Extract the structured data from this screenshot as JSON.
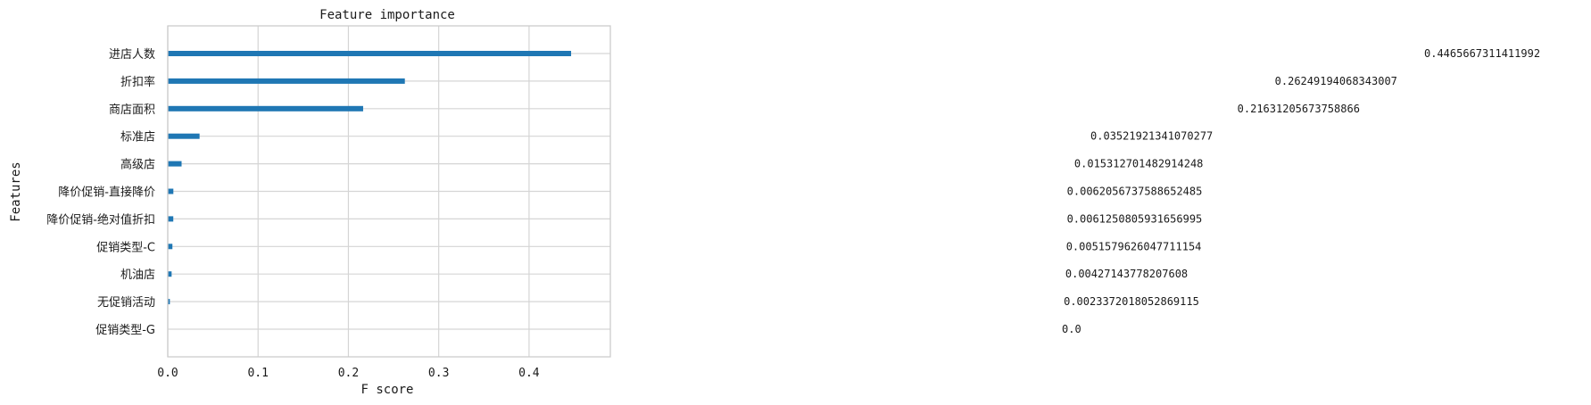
{
  "chart_data": {
    "type": "bar",
    "orientation": "horizontal",
    "title": "Feature importance",
    "xlabel": "F score",
    "ylabel": "Features",
    "categories": [
      "进店人数",
      "折扣率",
      "商店面积",
      "标准店",
      "高级店",
      "降价促销-直接降价",
      "降价促销-绝对值折扣",
      "促销类型-C",
      "机油店",
      "无促销活动",
      "促销类型-G"
    ],
    "values": [
      0.4465667311411992,
      0.26249194068343007,
      0.21631205673758866,
      0.03521921341070277,
      0.015312701482914248,
      0.0062056737588652485,
      0.0061250805931656995,
      0.0051579626047711154,
      0.00427143778207608,
      0.0023372018052869115,
      0.0
    ],
    "data_labels": [
      "0.4465667311411992",
      "0.26249194068343007",
      "0.21631205673758866",
      "0.03521921341070277",
      "0.015312701482914248",
      "0.0062056737588652485",
      "0.0061250805931656995",
      "0.0051579626047711154",
      "0.00427143778207608",
      "0.0023372018052869115",
      "0.0"
    ],
    "xticks": [
      "0.0",
      "0.1",
      "0.2",
      "0.3",
      "0.4"
    ],
    "xlim": [
      0,
      0.49
    ],
    "grid": true,
    "bar_color": "#1f77b4"
  }
}
